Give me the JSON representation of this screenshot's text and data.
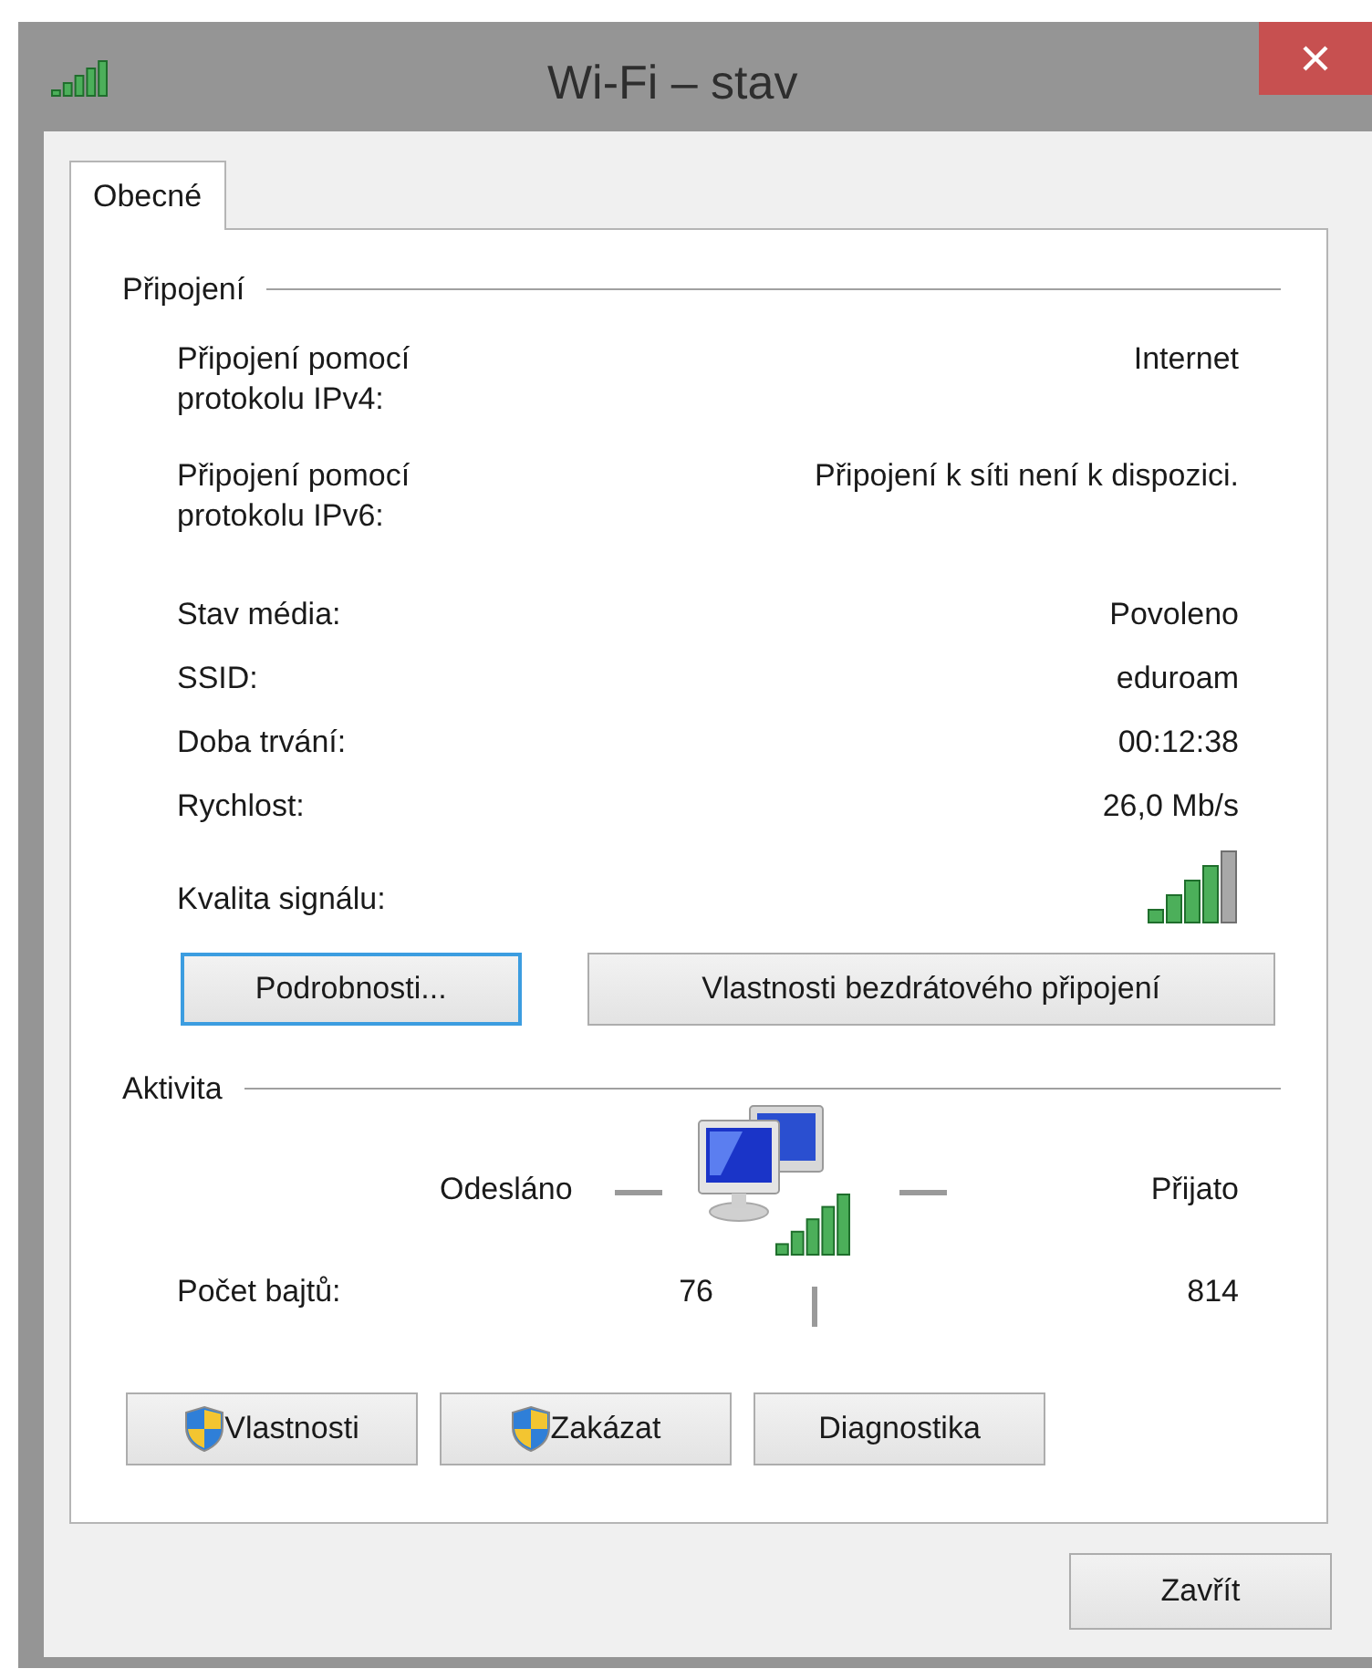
{
  "window": {
    "title": "Wi-Fi – stav"
  },
  "tabs": [
    {
      "label": "Obecné",
      "selected": true
    }
  ],
  "connection": {
    "heading": "Připojení",
    "rows": [
      {
        "label": "Připojení pomocí protokolu IPv4:",
        "value": "Internet"
      },
      {
        "label": "Připojení pomocí protokolu IPv6:",
        "value": "Připojení k síti není k dispozici."
      },
      {
        "label": "Stav média:",
        "value": "Povoleno"
      },
      {
        "label": "SSID:",
        "value": "eduroam"
      },
      {
        "label": "Doba trvání:",
        "value": "00:12:38"
      },
      {
        "label": "Rychlost:",
        "value": "26,0 Mb/s"
      }
    ],
    "signal_label": "Kvalita signálu:",
    "buttons": [
      {
        "label": "Podrobnosti...",
        "focused": true
      },
      {
        "label": "Vlastnosti bezdrátového připojení",
        "focused": false
      }
    ]
  },
  "activity": {
    "heading": "Aktivita",
    "sent_label": "Odesláno",
    "received_label": "Přijato",
    "bytes_label": "Počet bajtů:",
    "sent": "76",
    "received": "814"
  },
  "actions": [
    {
      "label": "Vlastnosti",
      "kind": "shield"
    },
    {
      "label": "Zakázat",
      "kind": "shield"
    },
    {
      "label": "Diagnostika",
      "kind": "plain"
    }
  ],
  "close_button": "Zavřít"
}
